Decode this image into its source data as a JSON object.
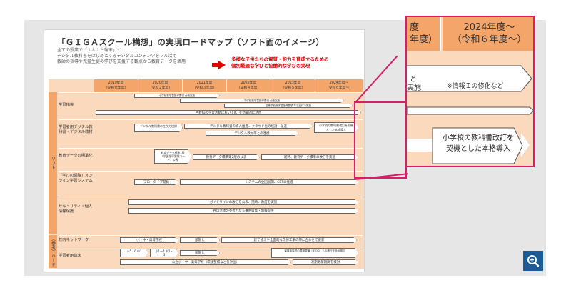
{
  "document": {
    "title": "「ＧＩＧＡスクール構想」の実現ロードマップ（ソフト面のイメージ）",
    "subtitles": [
      "全ての授業で「１人１台端末」と",
      "デジタル教科書をはじめとするデジタルコンテンツをフル活用",
      "教師の指導や児童生徒の学びを支援する観点から教育データを活用"
    ],
    "red_note": [
      "多様な子供たちの資質・能力を育成するための",
      "個別最適な学びと協働的な学びの実現"
    ],
    "years": [
      [
        "2019年度",
        "（令和元年度）"
      ],
      [
        "2020年度",
        "（令和２年度）"
      ],
      [
        "2021年度",
        "（令和３年度）"
      ],
      [
        "2022年度",
        "（令和４年度）"
      ],
      [
        "2023年度",
        "（令和５年度）"
      ],
      [
        "2024年度～",
        "（令和６年度～）"
      ]
    ],
    "soft_tab": "ソフト",
    "hard_tab": "（参考）ハード",
    "rows": [
      {
        "label": "学習指導",
        "bars": [
          "小学校新学習指導要領 全面実施",
          "中学校新学習指導要領 全面実施",
          "高等学校新学習指導要領 年次進行で実施",
          "各教科の学習活動においてICTを効果的に活用"
        ]
      },
      {
        "label": "学習者用デジタル教科書・デジタル教材",
        "bars": [
          "デジタル教科書の在り方検討",
          "デジタル教科書の導入推進、クラウド化の検討・促進",
          "デジタル教材等との連携",
          "小学校の教科書改訂を契機とした本格導入"
        ]
      },
      {
        "label": "教育データの標準化",
        "bars": [
          "教育データ標準1版（学習指導要領コード）公表",
          "教育データ標準第2版の公表",
          "随時、教育データ標準の改訂を実施"
        ]
      },
      {
        "label": "「学びの保障」オンライン学習システム",
        "bars": [
          "プロトタイプ開発",
          "システムの全国展開、CBTの推進"
        ]
      },
      {
        "label": "セキュリティ・個人情報保護",
        "bars": [
          "ガイドラインの改訂を公表、随時、改訂を実施",
          "各自治体の参考となる事例収集・情報提供"
        ]
      },
      {
        "label": "校内ネットワーク",
        "bars": [
          "小・中・高等学校",
          "順期し",
          "建て替えや全面的な改修工事の際に合わせて更新"
        ]
      },
      {
        "label": "学習者用端末",
        "bars": [
          "小5・6 中1",
          "小1～4 中2・3",
          "順期し",
          "保護者負担の環境整備（BYOD）への移行を含め検討",
          "公立小・中・高等学校（環境整備など各計画）",
          "次期更新期間を検討"
        ]
      }
    ]
  },
  "callout": {
    "year_partial": "度",
    "year_partial_sub": "年度）",
    "year_full": "2024年度～",
    "year_full_sub": "（令和６年度～）",
    "info_note": "※情報Ｉの修化など",
    "fragment_1": "と",
    "fragment_2": "実施",
    "highlight_text": [
      "小学校の教科書改訂を",
      "契機とした本格導入"
    ]
  },
  "zoom_button": {
    "icon": "zoom-in-icon"
  },
  "colors": {
    "accent": "#d81e6a",
    "header": "#f4a56a",
    "body": "#fad9bd",
    "button": "#1c5b95"
  }
}
